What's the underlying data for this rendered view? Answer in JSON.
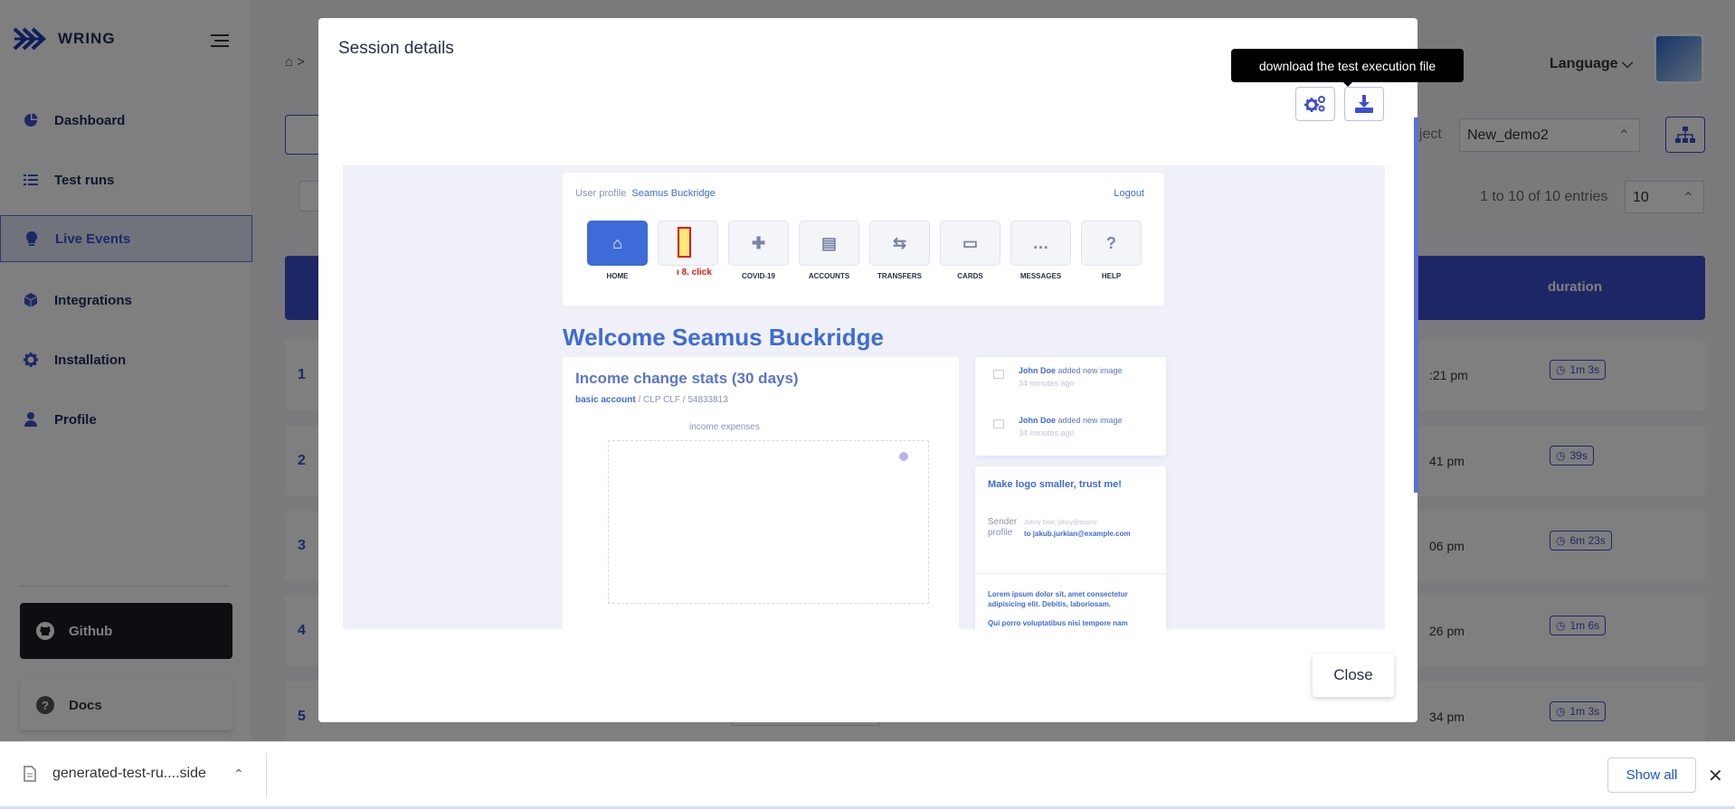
{
  "app": {
    "name": "WRING"
  },
  "sidebar": {
    "items": [
      {
        "label": "Dashboard",
        "icon": "pie-chart-icon"
      },
      {
        "label": "Test runs",
        "icon": "list-icon"
      },
      {
        "label": "Live Events",
        "icon": "lightbulb-icon"
      },
      {
        "label": "Integrations",
        "icon": "cube-icon"
      },
      {
        "label": "Installation",
        "icon": "gear-icon"
      },
      {
        "label": "Profile",
        "icon": "user-icon"
      }
    ],
    "github_label": "Github",
    "docs_label": "Docs"
  },
  "header": {
    "language_label": "Language"
  },
  "toolbar": {
    "project_label": "oject",
    "project_value": "New_demo2"
  },
  "table": {
    "entries_info": "1 to 10 of 10 entries",
    "page_size": "10",
    "duration_header": "duration",
    "rows": [
      {
        "num": "1",
        "time": ":21 pm",
        "duration": "1m 3s"
      },
      {
        "num": "2",
        "time": "41 pm",
        "duration": "39s"
      },
      {
        "num": "3",
        "time": "06 pm",
        "duration": "6m 23s"
      },
      {
        "num": "4",
        "time": "26 pm",
        "duration": "1m 6s"
      },
      {
        "num": "5",
        "time": "34 pm",
        "duration": "1m 3s"
      }
    ]
  },
  "modal": {
    "title": "Session details",
    "tooltip": "download the test execution file",
    "close_label": "Close",
    "preview": {
      "user_alt": "User profile",
      "user_name": "Seamus Buckridge",
      "logout": "Logout",
      "tiles": [
        "HOME",
        "",
        "COVID-19",
        "ACCOUNTS",
        "TRANSFERS",
        "CARDS",
        "MESSAGES",
        "HELP"
      ],
      "click_label": "8. click",
      "welcome": "Welcome Seamus Buckridge",
      "stats_title": "Income change stats (30 days)",
      "stats_account": "basic account",
      "stats_sub": " / CLP CLF / 54833813",
      "legend": "income  expenses",
      "feed": [
        {
          "name": "John Doe",
          "action": " added new image",
          "time": "34 minutes ago"
        },
        {
          "name": "John Doe",
          "action": " added new image",
          "time": "34 minutes ago"
        }
      ],
      "msg_title": "Make logo smaller, trust me!",
      "msg_sender_alt": "Sender profile",
      "msg_from": "Johny Doe, johny@teamo",
      "msg_to": "to jakub.jurkian@example.com",
      "msg_body_1": "Lorem ipsum dolor sit, amet consectetur adipisicing elit. Debitis, laboriosam.",
      "msg_body_2": "Qui porro voluptatibus nisi tempore nam"
    }
  },
  "downloads": {
    "file_name": "generated-test-ru....side",
    "show_all": "Show all"
  }
}
